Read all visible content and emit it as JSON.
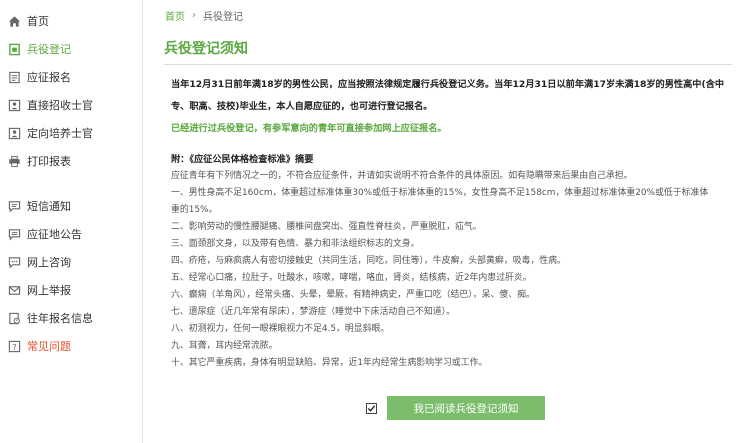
{
  "sidebar": {
    "items": [
      {
        "label": "首页",
        "icon": "home-icon"
      },
      {
        "label": "兵役登记",
        "icon": "register-icon"
      },
      {
        "label": "应征报名",
        "icon": "form-icon"
      },
      {
        "label": "直接招收士官",
        "icon": "id-card-icon"
      },
      {
        "label": "定向培养士官",
        "icon": "id-card-icon"
      },
      {
        "label": "打印报表",
        "icon": "printer-icon"
      },
      {
        "label": "短信通知",
        "icon": "message-icon"
      },
      {
        "label": "应征地公告",
        "icon": "bulletin-icon"
      },
      {
        "label": "网上咨询",
        "icon": "chat-icon"
      },
      {
        "label": "网上举报",
        "icon": "mail-icon"
      },
      {
        "label": "往年报名信息",
        "icon": "history-icon"
      },
      {
        "label": "常见问题",
        "icon": "question-icon"
      }
    ]
  },
  "breadcrumb": {
    "home": "首页",
    "separator": "›",
    "current": "兵役登记"
  },
  "page_title": "兵役登记须知",
  "notice": {
    "intro_line1": "当年12月31日前年满18岁的男性公民，应当按照法律规定履行兵役登记义务。当年12月31日以前年满17岁未满18岁的男性高中(含中",
    "intro_line2": "专、职高、技校)毕业生，本人自愿应征的，也可进行登记报名。",
    "green_note": "已经进行过兵役登记，有参军意向的青年可直接参加网上应征报名。",
    "appendix_title": "附：《应征公民体格检查标准》摘要",
    "lines": [
      "应征青年有下列情况之一的，不符合应征条件，并请如实说明不符合条件的具体原因。如有隐瞒带来后果由自己承担。",
      "一、男性身高不足160cm，体重超过标准体重30%或低于标准体重的15%，女性身高不足158cm，体重超过标准体重20%或低于标准体",
      "重的15%。",
      "二、影响劳动的慢性腰腿痛、腰椎间盘突出、强直性脊柱炎，严重脱肛，疝气。",
      "三、面颈部文身，以及带有色情、暴力和非法组织标志的文身。",
      "四、疥疮，与麻疯病人有密切接触史（共同生活，同吃，同住等），牛皮癣，头部黄癣，吸毒，性病。",
      "五、经常心口痛，拉肚子，吐酸水，咳嗽，哮喘，咯血，肾炎，结核病，近2年内患过肝炎。",
      "六、癫痫（羊角风），经常头痛、头晕，晕厥，有精神病史，严重口吃（结巴），呆、傻、痴。",
      "七、遗尿症（近几年常有尿床），梦游症（睡觉中下床活动自己不知道）。",
      "八、初测视力，任何一眼裸眼视力不足4.5，明显斜眼。",
      "九、耳聋，耳内经常流脓。",
      "十、其它严重疾病，身体有明显缺陷、异常，近1年内经常生病影响学习或工作。"
    ]
  },
  "agree": {
    "checked": true,
    "button_label": "我已阅读兵役登记须知"
  },
  "colors": {
    "accent": "#5aa83f",
    "button": "#7bbd6a",
    "warn": "#e0512c"
  }
}
